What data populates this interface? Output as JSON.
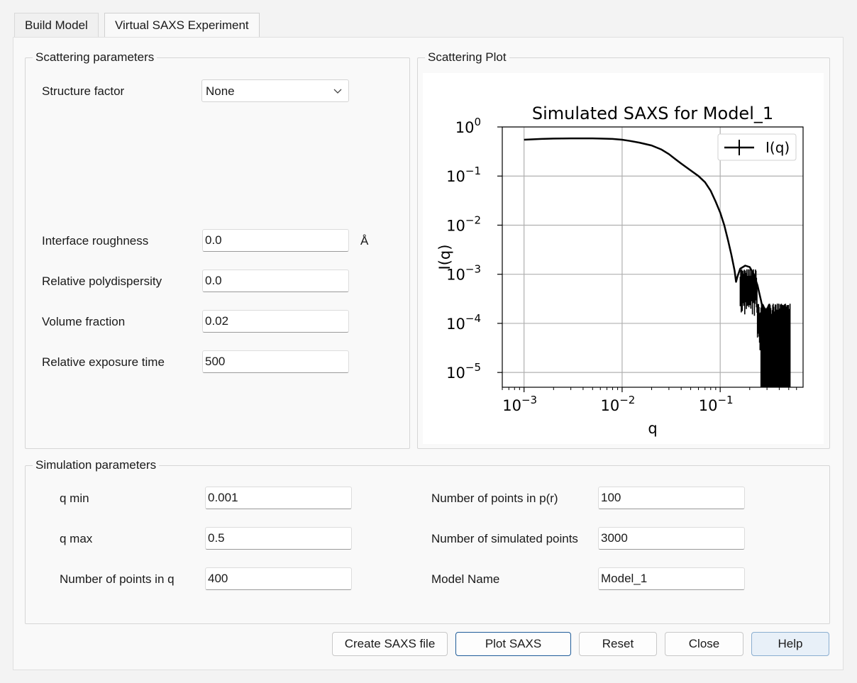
{
  "tabs": [
    {
      "label": "Build Model",
      "active": false
    },
    {
      "label": "Virtual SAXS Experiment",
      "active": true
    }
  ],
  "scattering": {
    "title": "Scattering parameters",
    "structure_factor": {
      "label": "Structure factor",
      "value": "None"
    },
    "interface_roughness": {
      "label": "Interface roughness",
      "value": "0.0",
      "unit": "Å"
    },
    "polydispersity": {
      "label": "Relative polydispersity",
      "value": "0.0"
    },
    "volume_fraction": {
      "label": "Volume fraction",
      "value": "0.02"
    },
    "exposure_time": {
      "label": "Relative exposure time",
      "value": "500"
    }
  },
  "plot_group": {
    "title": "Scattering Plot"
  },
  "simulation": {
    "title": "Simulation parameters",
    "q_min": {
      "label": "q min",
      "value": "0.001"
    },
    "q_max": {
      "label": "q max",
      "value": "0.5"
    },
    "n_q": {
      "label": "Number of points in q",
      "value": "400"
    },
    "n_pr": {
      "label": "Number of points in p(r)",
      "value": "100"
    },
    "n_sim": {
      "label": "Number of simulated points",
      "value": "3000"
    },
    "model_name": {
      "label": "Model Name",
      "value": "Model_1"
    }
  },
  "buttons": {
    "create": "Create SAXS file",
    "plot": "Plot SAXS",
    "reset": "Reset",
    "close": "Close",
    "help": "Help"
  },
  "chart_data": {
    "type": "line",
    "title": "Simulated SAXS for Model_1",
    "xlabel": "q",
    "ylabel": "I(q)",
    "xscale": "log",
    "yscale": "log",
    "xlim": [
      0.0006,
      0.7
    ],
    "ylim": [
      5e-06,
      1.0
    ],
    "xticks": [
      0.001,
      0.01,
      0.1
    ],
    "yticks": [
      1,
      0.1,
      0.01,
      0.001,
      0.0001,
      1e-05
    ],
    "grid": true,
    "legend": "top-right",
    "color": "#000000",
    "series": [
      {
        "name": "I(q)",
        "x": [
          0.001,
          0.0015,
          0.002,
          0.003,
          0.004,
          0.005,
          0.006,
          0.007,
          0.008,
          0.01,
          0.012,
          0.015,
          0.02,
          0.025,
          0.03,
          0.035,
          0.04,
          0.05,
          0.06,
          0.07,
          0.08,
          0.09,
          0.1,
          0.11,
          0.12,
          0.13,
          0.14,
          0.145,
          0.15,
          0.16,
          0.18,
          0.2,
          0.22,
          0.24,
          0.26,
          0.28,
          0.3,
          0.33,
          0.36,
          0.4,
          0.45,
          0.5
        ],
        "y": [
          0.55,
          0.57,
          0.58,
          0.585,
          0.585,
          0.585,
          0.58,
          0.575,
          0.57,
          0.55,
          0.52,
          0.48,
          0.42,
          0.35,
          0.28,
          0.22,
          0.18,
          0.13,
          0.1,
          0.075,
          0.05,
          0.03,
          0.018,
          0.01,
          0.005,
          0.0025,
          0.0012,
          0.0007,
          0.0009,
          0.0013,
          0.0015,
          0.0014,
          0.001,
          0.0006,
          0.0003,
          0.00015,
          8e-05,
          4e-05,
          3e-05,
          2e-05,
          1.5e-05,
          1.2e-05
        ]
      }
    ]
  }
}
